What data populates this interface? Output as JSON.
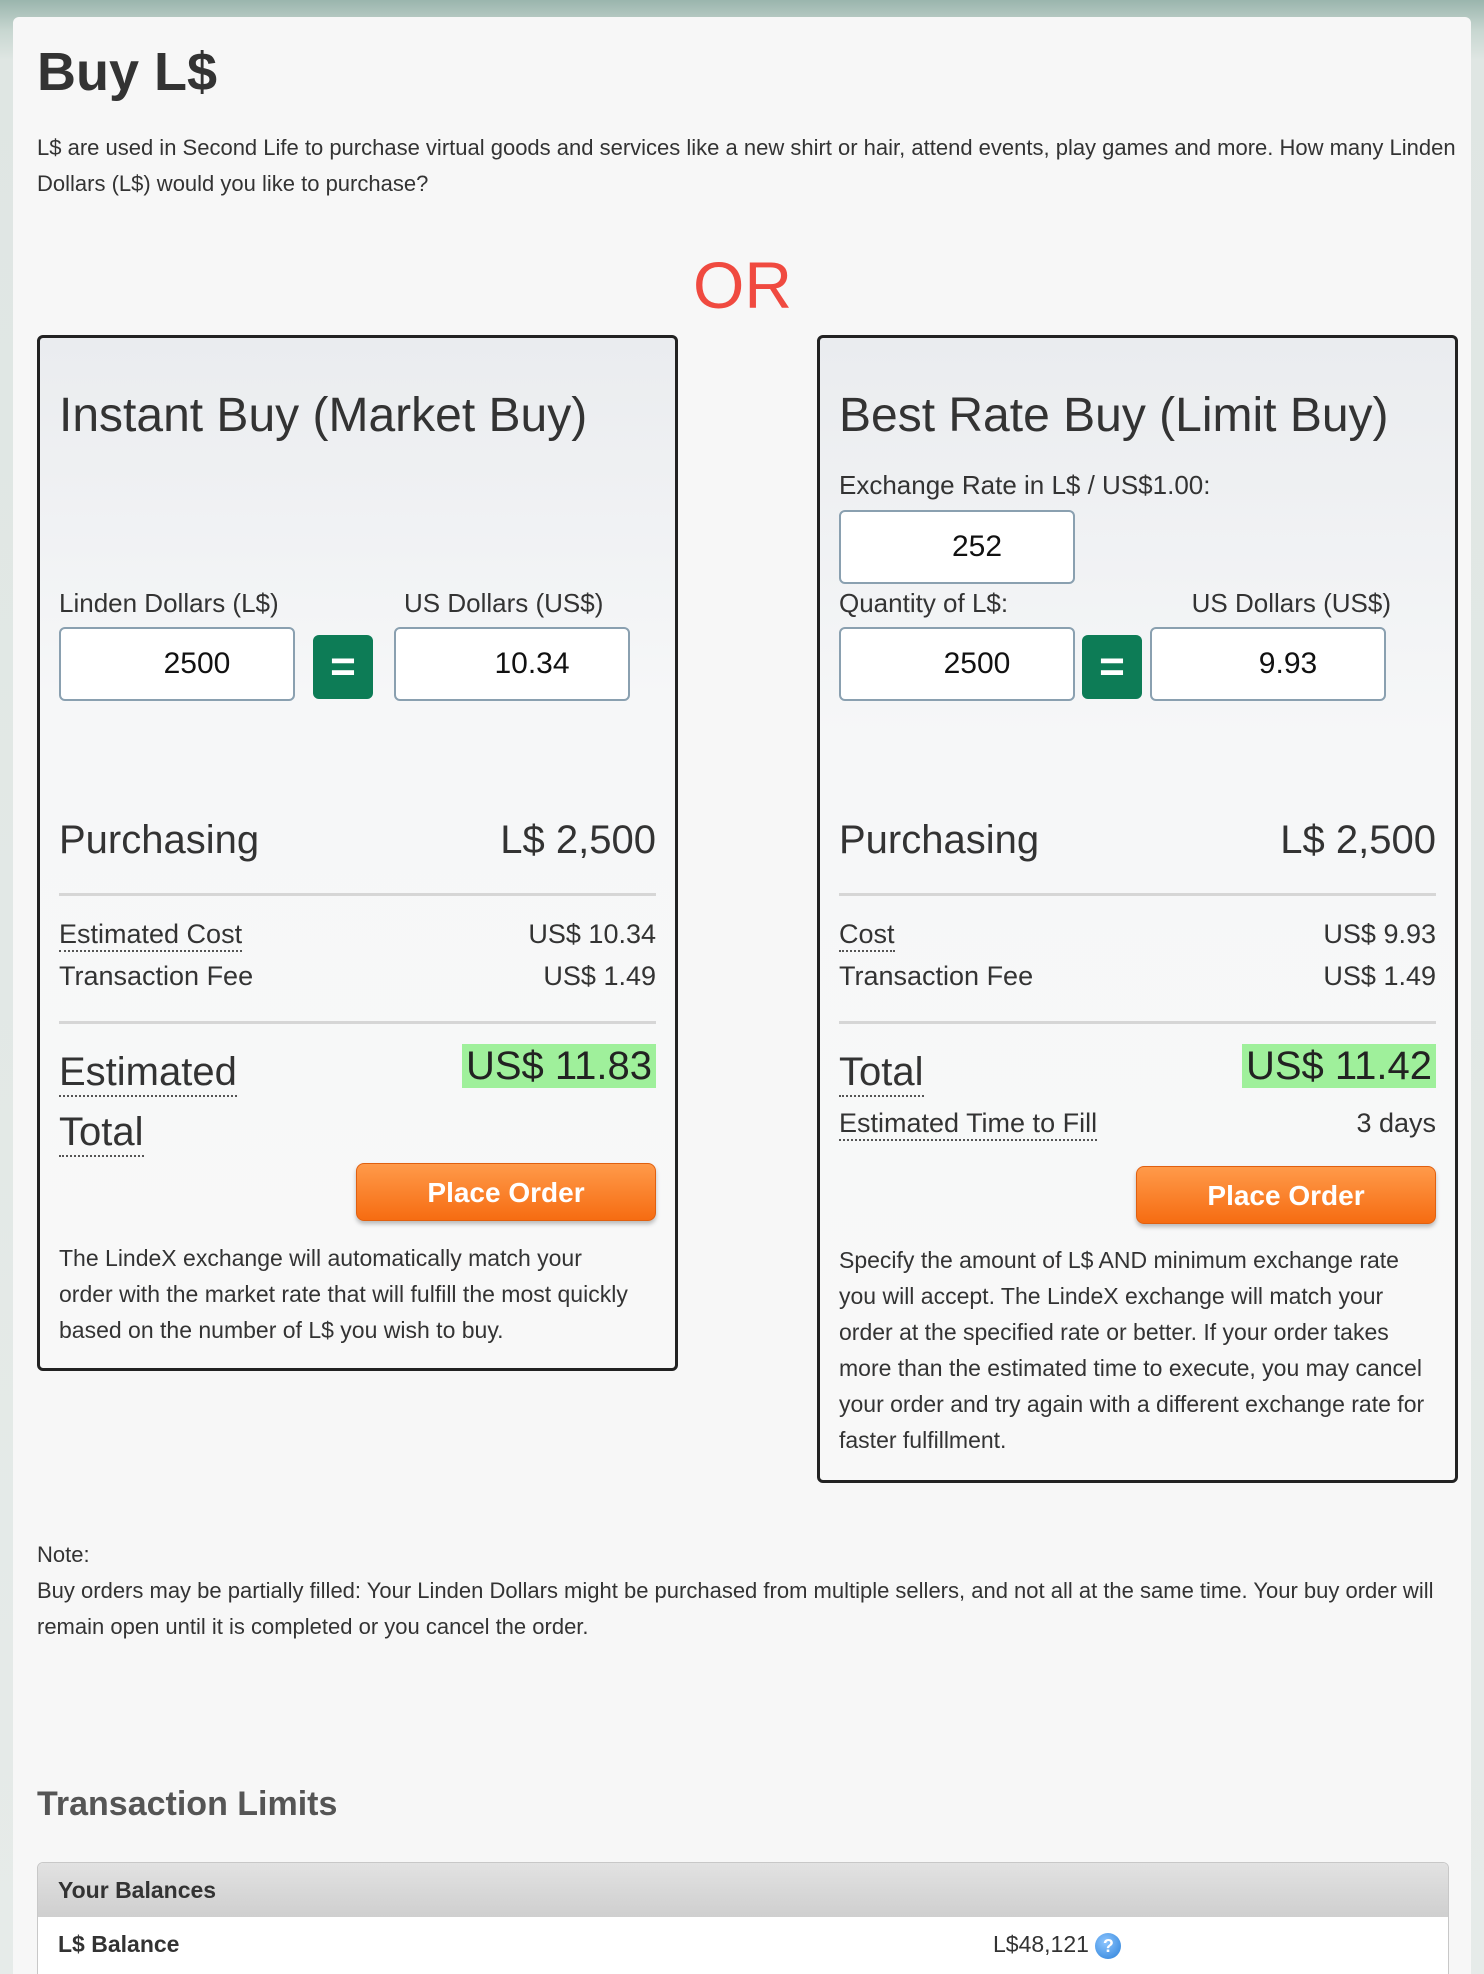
{
  "page": {
    "title": "Buy L$",
    "intro": "L$ are used in Second Life to purchase virtual goods and services like a new shirt or hair, attend events, play games and more. How many Linden Dollars (L$) would you like to purchase?",
    "or_label": "OR"
  },
  "instant": {
    "title": "Instant Buy (Market Buy)",
    "linden_label": "Linden Dollars (L$)",
    "usd_label": "US Dollars (US$)",
    "linden_value": "2500",
    "usd_value": "10.34",
    "eq_label": "=",
    "purchasing_label": "Purchasing",
    "purchasing_value": "L$ 2,500",
    "cost_label": "Estimated Cost",
    "cost_value": "US$ 10.34",
    "fee_label": "Transaction Fee",
    "fee_value": "US$ 1.49",
    "total_label_1": "Estimated",
    "total_label_2": "Total",
    "total_value": "US$ 11.83",
    "button": "Place Order",
    "description": "The LindeX exchange will automatically match your order with the market rate that will fulfill the most quickly based on the number of L$ you wish to buy."
  },
  "limit": {
    "title": "Best Rate Buy (Limit Buy)",
    "rate_label": "Exchange Rate in L$ / US$1.00:",
    "rate_value": "252",
    "qty_label": "Quantity of L$:",
    "usd_label": "US Dollars (US$)",
    "qty_value": "2500",
    "usd_value": "9.93",
    "eq_label": "=",
    "purchasing_label": "Purchasing",
    "purchasing_value": "L$ 2,500",
    "cost_label": "Cost",
    "cost_value": "US$ 9.93",
    "fee_label": "Transaction Fee",
    "fee_value": "US$ 1.49",
    "total_label": "Total",
    "total_value": "US$ 11.42",
    "fill_label": "Estimated Time to Fill",
    "fill_value": "3 days",
    "button": "Place Order",
    "description": "Specify the amount of L$ AND minimum exchange rate you will accept. The LindeX exchange will match your order at the specified rate or better. If your order takes more than the estimated time to execute, you may cancel your order and try again with a different exchange rate for faster fulfillment."
  },
  "note": {
    "heading": "Note:",
    "text": "Buy orders may be partially filled: Your Linden Dollars might be purchased from multiple sellers, and not all at the same time. Your buy order will remain open until it is completed or you cancel the order."
  },
  "limits": {
    "title": "Transaction Limits",
    "table_header": "Your Balances",
    "rows": [
      {
        "label": "L$ Balance",
        "value": "L$48,121",
        "icon": "help-icon"
      }
    ]
  },
  "colors": {
    "accent_green": "#0d7c56",
    "order_orange": "#f66c12",
    "total_highlight": "#9ff09b",
    "or_red": "#f04a40"
  }
}
